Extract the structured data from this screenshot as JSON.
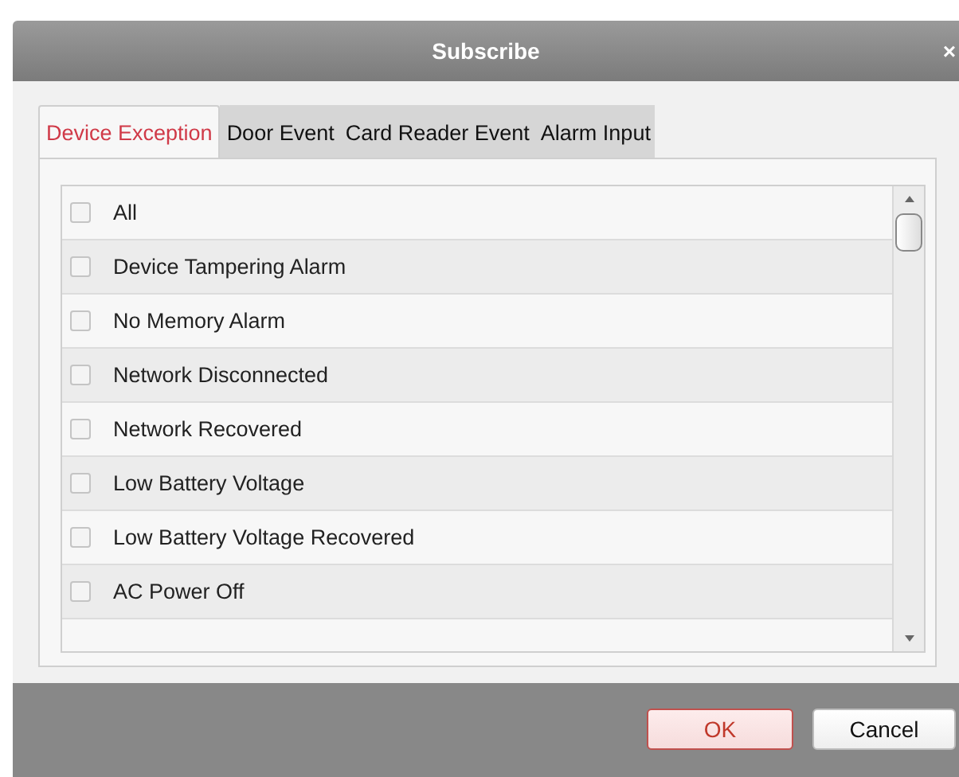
{
  "window": {
    "title": "Subscribe",
    "close": "×"
  },
  "tabs": [
    {
      "label": "Device Exception",
      "selected": true
    },
    {
      "label": "Door Event",
      "selected": false
    },
    {
      "label": "Card Reader Event",
      "selected": false
    },
    {
      "label": "Alarm Input",
      "selected": false
    }
  ],
  "items": [
    {
      "label": "All",
      "checked": false
    },
    {
      "label": "Device Tampering Alarm",
      "checked": false
    },
    {
      "label": "No Memory Alarm",
      "checked": false
    },
    {
      "label": "Network Disconnected",
      "checked": false
    },
    {
      "label": "Network Recovered",
      "checked": false
    },
    {
      "label": "Low Battery Voltage",
      "checked": false
    },
    {
      "label": "Low Battery Voltage Recovered",
      "checked": false
    },
    {
      "label": "AC Power Off",
      "checked": false
    }
  ],
  "buttons": [
    {
      "label": "OK",
      "kind": "primary"
    },
    {
      "label": "Cancel",
      "kind": "secondary"
    }
  ]
}
